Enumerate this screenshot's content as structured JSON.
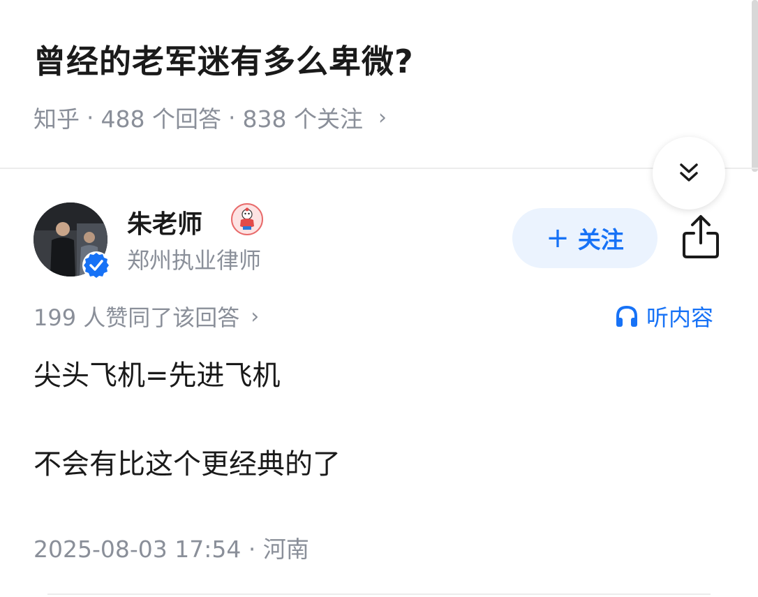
{
  "question": {
    "title": "曾经的老军迷有多么卑微?",
    "source": "知乎",
    "separator": "·",
    "answers": "488 个回答",
    "followers": "838 个关注",
    "chevron": "›"
  },
  "author": {
    "name": "朱老师",
    "bio": "郑州执业律师",
    "verified_icon": "verified-check-icon",
    "emblem_icon": "badge-emblem-icon",
    "follow_plus": "+",
    "follow_label": "关注",
    "share_icon": "share-icon"
  },
  "answer": {
    "votes": "199 人赞同了该回答",
    "votes_chevron": "›",
    "listen_label": "听内容",
    "listen_icon": "headphones-icon",
    "lines": [
      "尖头飞机=先进飞机",
      "不会有比这个更经典的了"
    ],
    "date": "2025-08-03 17:54 · 河南"
  },
  "controls": {
    "collapse_icon": "double-chevron-down-icon"
  },
  "colors": {
    "accent": "#1772f6",
    "follow_bg": "#ebf3fe",
    "meta_text": "#8a8f99",
    "title_text": "#1a1a1a"
  }
}
